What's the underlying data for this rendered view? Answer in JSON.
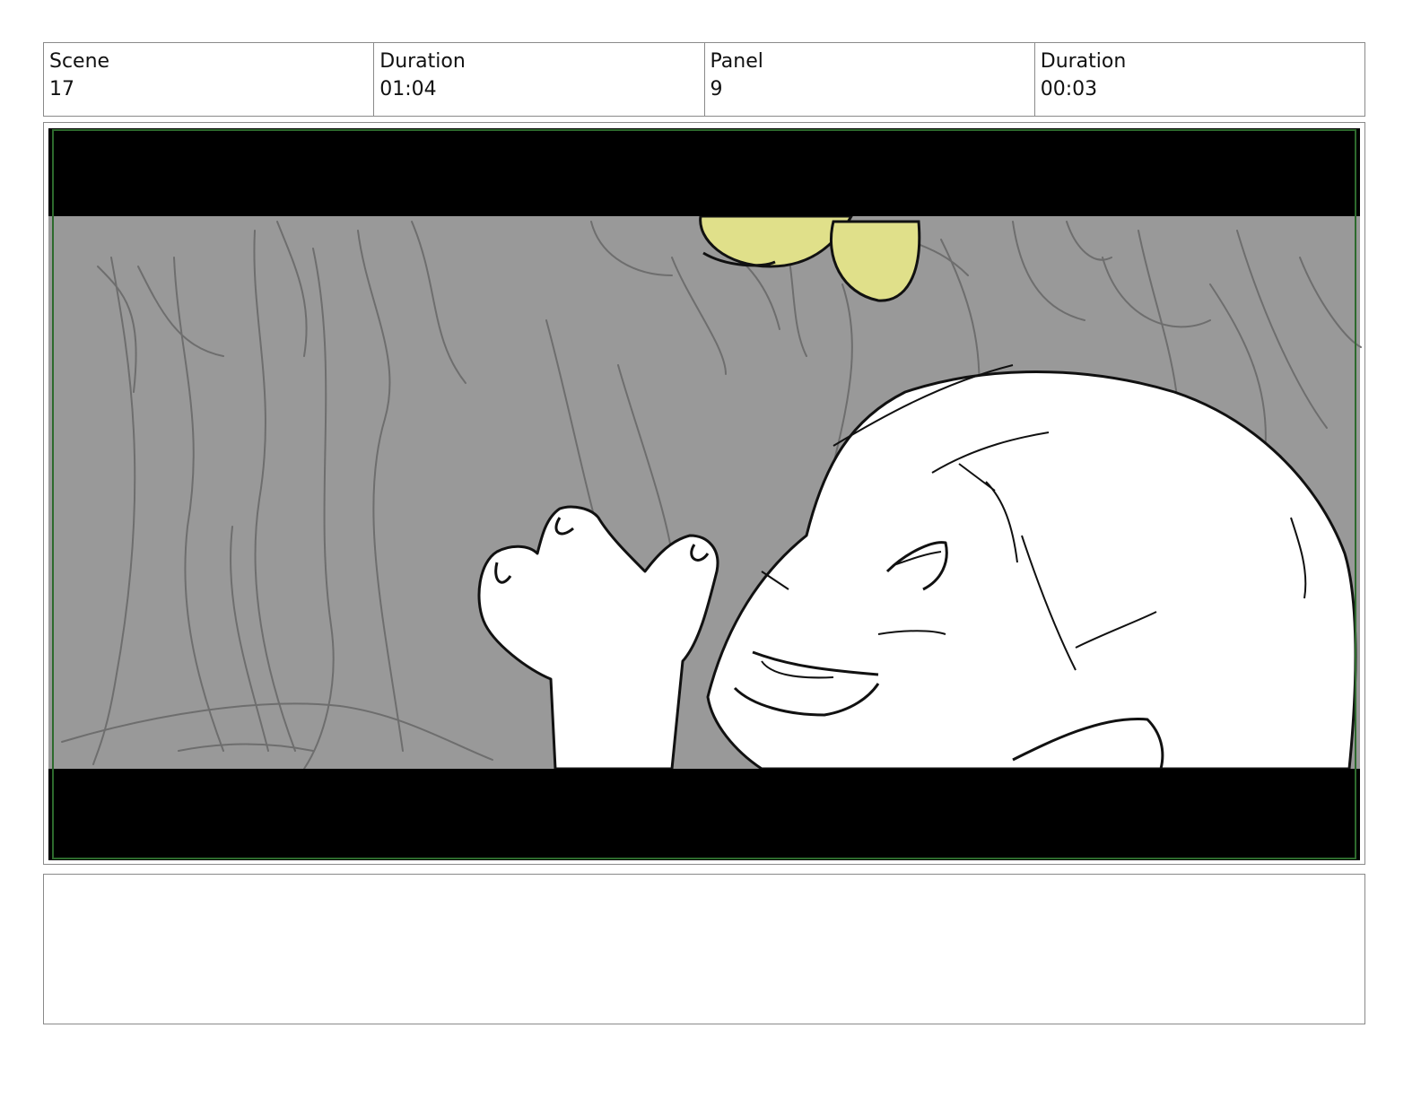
{
  "header": {
    "scene_label": "Scene",
    "scene_value": "17",
    "scene_duration_label": "Duration",
    "scene_duration_value": "01:04",
    "panel_label": "Panel",
    "panel_value": "9",
    "panel_duration_label": "Duration",
    "panel_duration_value": "00:03"
  },
  "panel_image": {
    "icon": "storyboard-sketch",
    "colors": {
      "letterbox": "#000000",
      "background": "#999999",
      "sketch_line": "#6e6e6e",
      "character_fill": "#ffffff",
      "accent_yellow": "#e0e08a",
      "safe_frame": "#2d6a2d"
    }
  },
  "notes": {
    "text": ""
  }
}
